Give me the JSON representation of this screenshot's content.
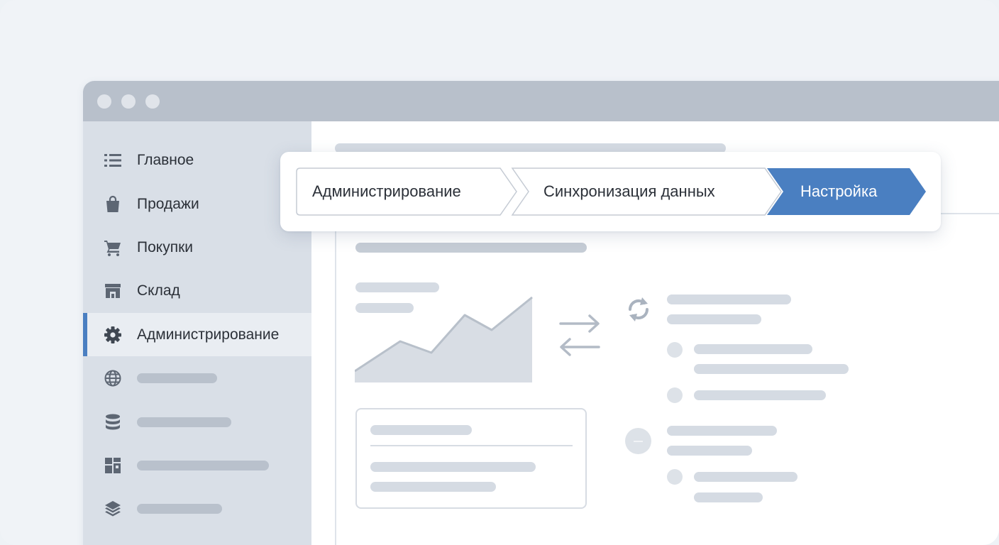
{
  "sidebar": {
    "items": [
      {
        "label": "Главное",
        "icon": "list-icon"
      },
      {
        "label": "Продажи",
        "icon": "shopping-bag-icon"
      },
      {
        "label": "Покупки",
        "icon": "shopping-cart-icon"
      },
      {
        "label": "Склад",
        "icon": "warehouse-icon"
      },
      {
        "label": "Администрирование",
        "icon": "gear-icon",
        "active": true
      },
      {
        "label": "",
        "icon": "globe-icon"
      },
      {
        "label": "",
        "icon": "database-icon"
      },
      {
        "label": "",
        "icon": "dashboard-icon"
      },
      {
        "label": "",
        "icon": "layers-icon"
      }
    ]
  },
  "breadcrumb": {
    "items": [
      {
        "label": "Администрирование"
      },
      {
        "label": "Синхронизация данных"
      },
      {
        "label": "Настройка",
        "current": true
      }
    ]
  },
  "colors": {
    "accent": "#4a7fc1",
    "sidebar_bg": "#d9dfe7",
    "titlebar": "#b8c0cb",
    "placeholder": "#d5dbe3"
  },
  "icons": {
    "chart": "area-chart-icon",
    "transfer": "transfer-arrows-icon",
    "sync": "sync-icon"
  }
}
